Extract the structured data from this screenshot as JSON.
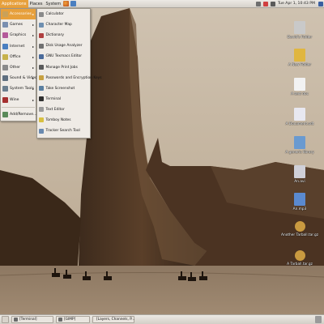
{
  "top_panel": {
    "menus": [
      "Applications",
      "Places",
      "System"
    ],
    "clock": "Tue Apr 1, 10:43 PM"
  },
  "applications_menu": {
    "items": [
      {
        "label": "Accessories",
        "icon": "accessories-icon",
        "color": "#c9a15a",
        "submenu": true,
        "active": true
      },
      {
        "label": "Games",
        "icon": "games-icon",
        "color": "#7a8fb0",
        "submenu": true
      },
      {
        "label": "Graphics",
        "icon": "graphics-icon",
        "color": "#b45a9a",
        "submenu": true
      },
      {
        "label": "Internet",
        "icon": "internet-icon",
        "color": "#4a7fc0",
        "submenu": true
      },
      {
        "label": "Office",
        "icon": "office-icon",
        "color": "#c7b24a",
        "submenu": true
      },
      {
        "label": "Other",
        "icon": "other-icon",
        "color": "#8a8a8a",
        "submenu": true
      },
      {
        "label": "Sound & Video",
        "icon": "sound-video-icon",
        "color": "#5f6f7f",
        "submenu": true
      },
      {
        "label": "System Tools",
        "icon": "system-tools-icon",
        "color": "#6b7f8f",
        "submenu": true
      },
      {
        "label": "Wine",
        "icon": "wine-icon",
        "color": "#a53030",
        "submenu": true
      }
    ],
    "footer_item": {
      "label": "Add/Remove...",
      "icon": "add-remove-icon",
      "color": "#5a8a5a"
    }
  },
  "accessories_submenu": {
    "items": [
      {
        "label": "Calculator",
        "icon": "calculator-icon",
        "color": "#8a8a8a"
      },
      {
        "label": "Character Map",
        "icon": "character-map-icon",
        "color": "#6f8fb0"
      },
      {
        "label": "Dictionary",
        "icon": "dictionary-icon",
        "color": "#b04040"
      },
      {
        "label": "Disk Usage Analyzer",
        "icon": "disk-usage-icon",
        "color": "#707070"
      },
      {
        "label": "GNU Texmacs Editor",
        "icon": "texmacs-icon",
        "color": "#4a6a9a"
      },
      {
        "label": "Manage Print Jobs",
        "icon": "print-jobs-icon",
        "color": "#5a5a5a"
      },
      {
        "label": "Passwords and Encryption Keys",
        "icon": "passwords-icon",
        "color": "#c7a040"
      },
      {
        "label": "Take Screenshot",
        "icon": "screenshot-icon",
        "color": "#5a7fa0"
      },
      {
        "label": "Terminal",
        "icon": "terminal-icon",
        "color": "#2f2f2f"
      },
      {
        "label": "Text Editor",
        "icon": "text-editor-icon",
        "color": "#9a9a9a"
      },
      {
        "label": "Tomboy Notes",
        "icon": "tomboy-icon",
        "color": "#d8c040"
      },
      {
        "label": "Tracker Search Tool",
        "icon": "tracker-search-icon",
        "color": "#6a8ab0"
      }
    ]
  },
  "desktop_icons": [
    {
      "label": "David's Folder",
      "icon": "home-folder-icon",
      "color": "#c9c9c9"
    },
    {
      "label": "A New Folder",
      "icon": "folder-icon",
      "color": "#e0b640"
    },
    {
      "label": "A text doc",
      "icon": "text-document-icon",
      "color": "#f2f2f2"
    },
    {
      "label": "A Document.odt",
      "icon": "odt-document-icon",
      "color": "#e8e8f0"
    },
    {
      "label": "A generic library",
      "icon": "library-icon",
      "color": "#6a9ad0"
    },
    {
      "label": "An.avi",
      "icon": "video-file-icon",
      "color": "#d0d0d8"
    },
    {
      "label": "An.mp3",
      "icon": "audio-file-icon",
      "color": "#5a8ad0"
    },
    {
      "label": "Another Tarball.tar.gz",
      "icon": "archive-icon",
      "color": "#c99a40"
    },
    {
      "label": "A Tarball.tar.gz",
      "icon": "archive-icon",
      "color": "#c99a40"
    }
  ],
  "taskbar": {
    "tasks": [
      "[Terminal]",
      "[GIMP]",
      "[Layers, Channels, P..."
    ]
  }
}
